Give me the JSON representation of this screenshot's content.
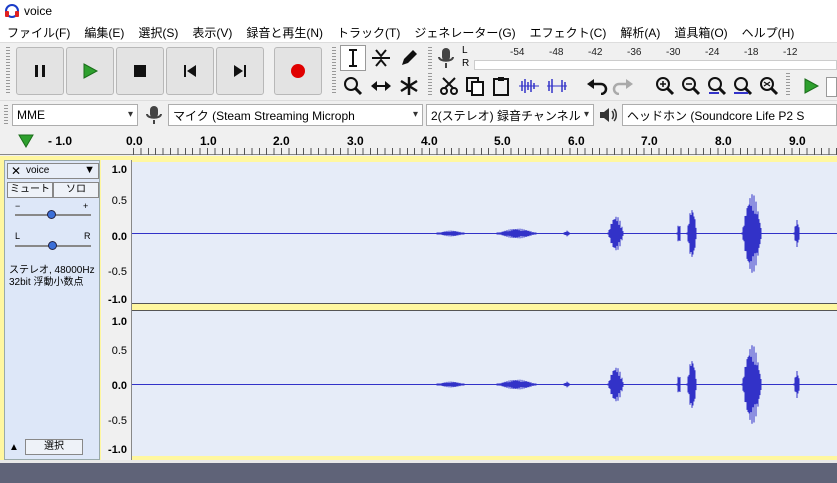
{
  "window": {
    "title": "voice"
  },
  "menu": [
    "ファイル(F)",
    "編集(E)",
    "選択(S)",
    "表示(V)",
    "録音と再生(N)",
    "トラック(T)",
    "ジェネレーター(G)",
    "エフェクト(C)",
    "解析(A)",
    "道具箱(O)",
    "ヘルプ(H)"
  ],
  "meter": {
    "channels": [
      "L",
      "R"
    ],
    "ticks": [
      "-54",
      "-48",
      "-42",
      "-36",
      "-30",
      "-24",
      "-18",
      "-12"
    ]
  },
  "devices": {
    "host": "MME",
    "input": "マイク (Steam Streaming Microph",
    "channels": "2(ステレオ) 録音チャンネル",
    "output": "ヘッドホン (Soundcore Life P2 S"
  },
  "ruler": {
    "labels": [
      "- 1.0",
      "0.0",
      "1.0",
      "2.0",
      "3.0",
      "4.0",
      "5.0",
      "6.0",
      "7.0",
      "8.0",
      "9.0"
    ]
  },
  "track": {
    "name": "voice",
    "mute": "ミュート",
    "solo": "ソロ",
    "gain_minus": "−",
    "gain_plus": "+",
    "pan_left": "L",
    "pan_right": "R",
    "info1": "ステレオ, 48000Hz",
    "info2": "32bit 浮動小数点",
    "select": "選択"
  },
  "scale": [
    "1.0",
    "0.5",
    "0.0",
    "-0.5",
    "-1.0"
  ],
  "colors": {
    "wave": "#3232c8",
    "waveBg": "#e6ecf8",
    "record": "#e00000",
    "play": "#1e9e1e"
  }
}
